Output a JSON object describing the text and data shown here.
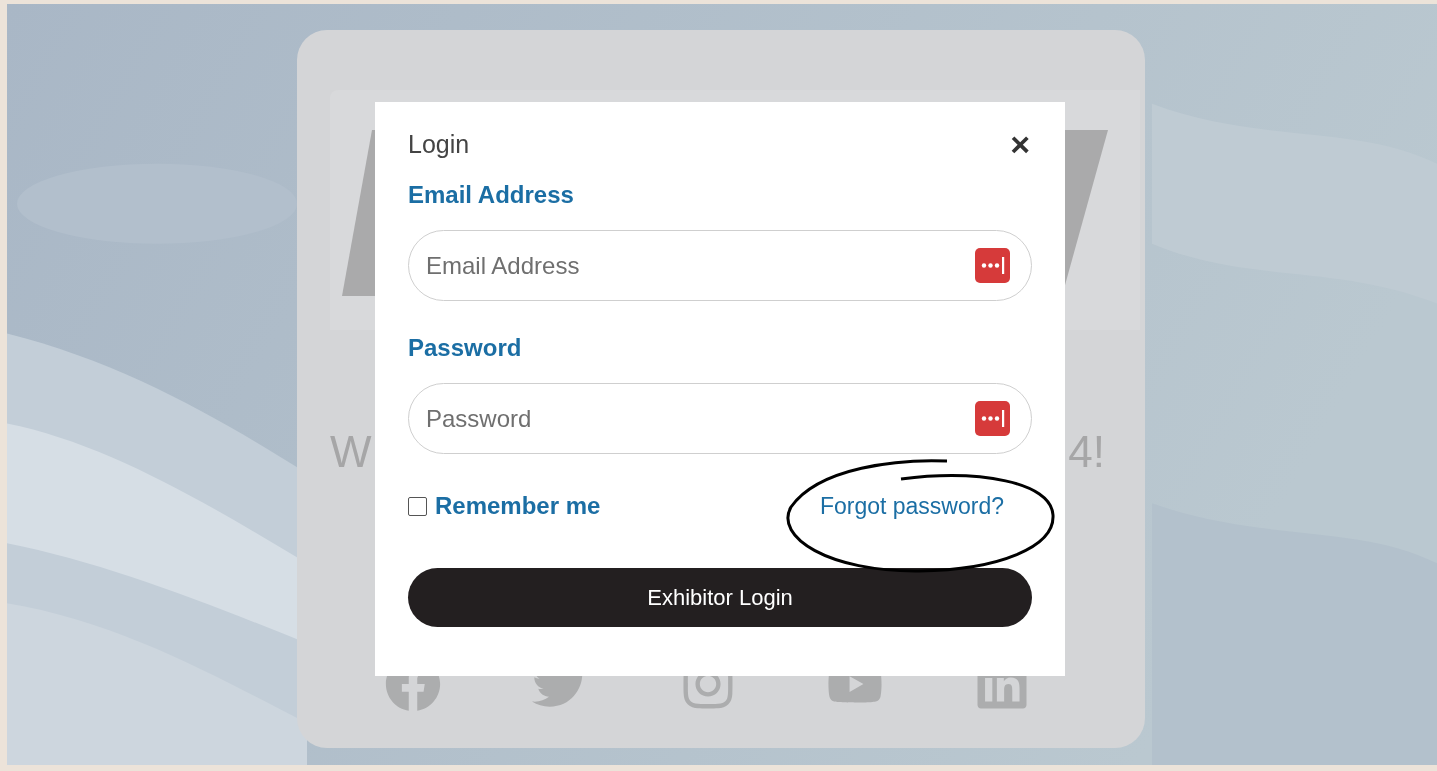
{
  "background_card": {
    "headline_visible": [
      "W",
      "4!"
    ]
  },
  "modal": {
    "title": "Login",
    "close": "×",
    "fields": [
      {
        "label": "Email Address",
        "placeholder": "Email Address"
      },
      {
        "label": "Password",
        "placeholder": "Password"
      }
    ],
    "remember": {
      "label": "Remember me",
      "checked": false
    },
    "forgot_link": "Forgot password?",
    "submit": "Exhibitor Login"
  }
}
